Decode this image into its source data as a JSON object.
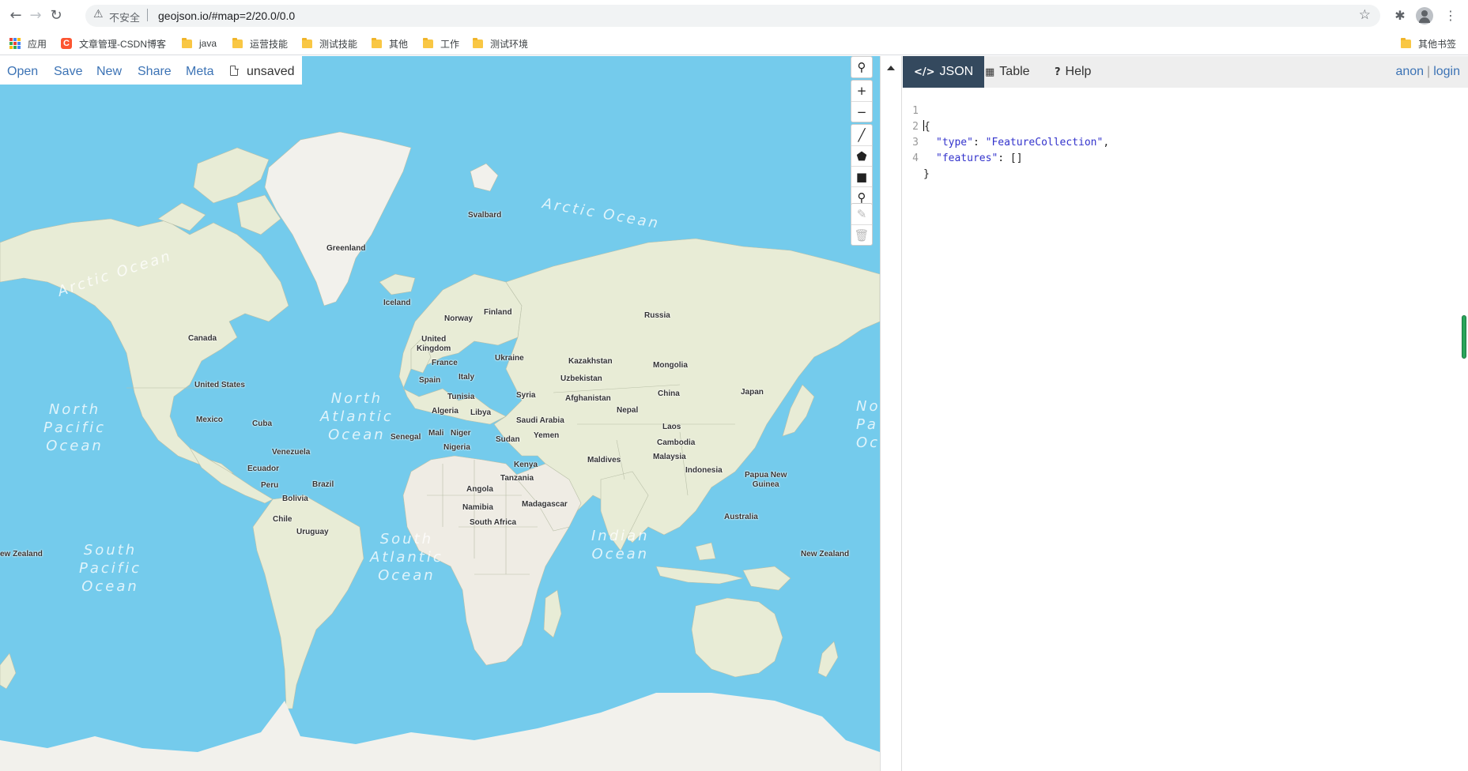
{
  "browser": {
    "security_label": "不安全",
    "url": "geojson.io/#map=2/20.0/0.0",
    "bookmarks": [
      {
        "label": "应用",
        "icon": "apps-icon"
      },
      {
        "label": "文章管理-CSDN博客",
        "icon": "csdn-icon"
      },
      {
        "label": "java",
        "icon": "folder-icon"
      },
      {
        "label": "运营技能",
        "icon": "folder-icon"
      },
      {
        "label": "测试技能",
        "icon": "folder-icon"
      },
      {
        "label": "其他",
        "icon": "folder-icon"
      },
      {
        "label": "工作",
        "icon": "folder-icon"
      },
      {
        "label": "测试环境",
        "icon": "folder-icon"
      },
      {
        "label": "其他书签",
        "icon": "folder-icon"
      }
    ]
  },
  "app": {
    "menu": {
      "open": "Open",
      "save": "Save",
      "new": "New",
      "share": "Share",
      "meta": "Meta"
    },
    "file_status": "unsaved",
    "tabs": {
      "json": "JSON",
      "table": "Table",
      "help": "Help"
    },
    "auth": {
      "anon": "anon",
      "separator": "|",
      "login": "login"
    },
    "editor": {
      "line_numbers": [
        "1",
        "2",
        "3",
        "4"
      ],
      "lines": {
        "l1": "{",
        "l2_key": "\"type\"",
        "l2_colon": ": ",
        "l2_value": "\"FeatureCollection\"",
        "l2_end": ",",
        "l3_key": "\"features\"",
        "l3_rest": ": []",
        "l4": "}"
      }
    },
    "map_controls": {
      "zoom_in": "+",
      "zoom_out": "−"
    }
  },
  "map": {
    "oceans": {
      "arctic_left": "Arctic Ocean",
      "arctic_top": "Arctic Ocean",
      "north_pacific_left": "North\nPacific\nOcean",
      "north_atlantic": "North\nAtlantic\nOcean",
      "north_pacific_right": "No\nPa\nOc",
      "south_pacific": "South\nPacific\nOcean",
      "south_atlantic": "South\nAtlantic\nOcean",
      "indian": "Indian\nOcean"
    },
    "places": {
      "svalbard": "Svalbard",
      "greenland": "Greenland",
      "iceland": "Iceland",
      "finland": "Finland",
      "norway": "Norway",
      "russia": "Russia",
      "canada": "Canada",
      "united_kingdom": "United\nKingdom",
      "ukraine": "Ukraine",
      "kazakhstan": "Kazakhstan",
      "france": "France",
      "mongolia": "Mongolia",
      "spain": "Spain",
      "italy": "Italy",
      "uzbekistan": "Uzbekistan",
      "united_states": "United States",
      "tunisia": "Tunisia",
      "syria": "Syria",
      "afghanistan": "Afghanistan",
      "china": "China",
      "japan": "Japan",
      "algeria": "Algeria",
      "libya": "Libya",
      "nepal": "Nepal",
      "mexico": "Mexico",
      "cuba": "Cuba",
      "saudi_arabia": "Saudi Arabia",
      "senegal": "Senegal",
      "mali": "Mali",
      "niger": "Niger",
      "yemen": "Yemen",
      "laos": "Laos",
      "sudan": "Sudan",
      "nigeria": "Nigeria",
      "cambodia": "Cambodia",
      "venezuela": "Venezuela",
      "maldives": "Maldives",
      "malaysia": "Malaysia",
      "ecuador": "Ecuador",
      "kenya": "Kenya",
      "indonesia": "Indonesia",
      "papua_new_guinea": "Papua New\nGuinea",
      "brazil": "Brazil",
      "peru": "Peru",
      "tanzania": "Tanzania",
      "angola": "Angola",
      "bolivia": "Bolivia",
      "madagascar": "Madagascar",
      "namibia": "Namibia",
      "australia": "Australia",
      "chile": "Chile",
      "south_africa": "South Africa",
      "uruguay": "Uruguay",
      "new_zealand_left": "ew Zealand",
      "new_zealand_right": "New Zealand"
    },
    "colors": {
      "ocean": "#74cbec",
      "land": "#e8ecd6",
      "land_ice": "#f2f1ec",
      "land_desert": "#efece4"
    }
  }
}
